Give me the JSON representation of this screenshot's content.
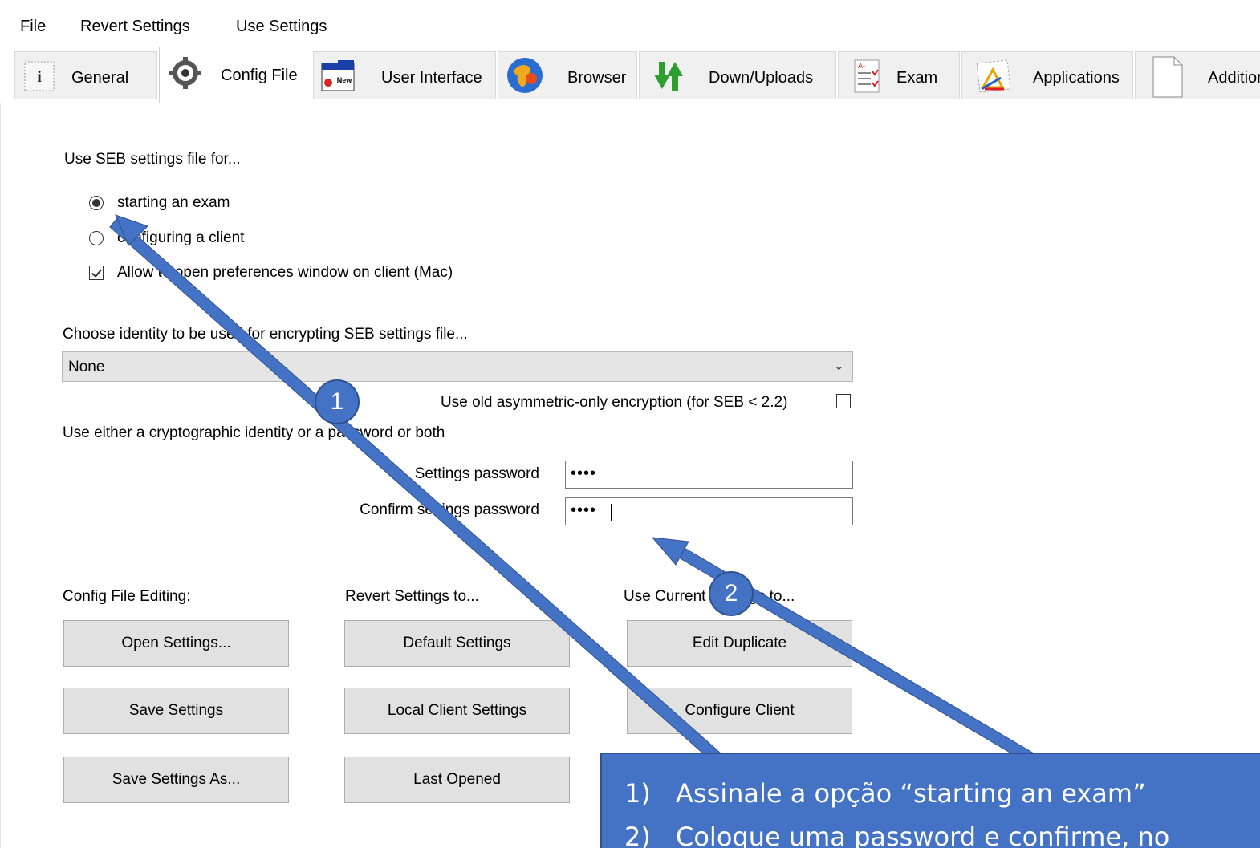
{
  "menu": [
    "File",
    "Revert Settings",
    "Use Settings"
  ],
  "tabs": [
    {
      "label": "General",
      "icon": "general-icon"
    },
    {
      "label": "Config File",
      "icon": "config-file-icon"
    },
    {
      "label": "User Interface",
      "icon": "user-interface-icon"
    },
    {
      "label": "Browser",
      "icon": "browser-globe-icon"
    },
    {
      "label": "Down/Uploads",
      "icon": "down-up-arrows-icon"
    },
    {
      "label": "Exam",
      "icon": "exam-sheet-icon"
    },
    {
      "label": "Applications",
      "icon": "applications-icon"
    },
    {
      "label": "Addition",
      "icon": "document-icon"
    }
  ],
  "active_tab": "Config File",
  "config": {
    "use_for_label": "Use SEB settings file for...",
    "radio_starting": "starting an exam",
    "radio_configuring": "configuring a client",
    "radio_selected": "starting an exam",
    "allow_prefs_label": "Allow to open preferences window on client (Mac)",
    "allow_prefs_checked": true,
    "identity_label": "Choose identity to be used for encrypting SEB settings file...",
    "identity_value": "None",
    "old_encryption_label": "Use old asymmetric-only encryption (for SEB < 2.2)",
    "old_encryption_checked": false,
    "either_label": "Use either a cryptographic identity or a password or both",
    "settings_password_label": "Settings password",
    "settings_password_value": "••••",
    "confirm_password_label": "Confirm settings password",
    "confirm_password_value": "••••"
  },
  "sections": {
    "editing_label": "Config File Editing:",
    "revert_label": "Revert Settings to...",
    "use_current_label": "Use Current Settings to..."
  },
  "buttons": {
    "open": "Open Settings...",
    "save": "Save Settings",
    "save_as": "Save Settings As...",
    "default": "Default Settings",
    "local_client": "Local Client Settings",
    "last_opened": "Last Opened",
    "edit_duplicate": "Edit Duplicate",
    "configure_client": "Configure Client"
  },
  "annotations": {
    "badge1": "1",
    "badge2": "2",
    "note_line1_num": "1)",
    "note_line1": "Assinale a opção “starting an exam”",
    "note_line2_num": "2)",
    "note_line2": "Coloque uma password e confirme, no"
  },
  "colors": {
    "annotation_blue": "#4472c4",
    "annotation_border": "#2f528f"
  }
}
